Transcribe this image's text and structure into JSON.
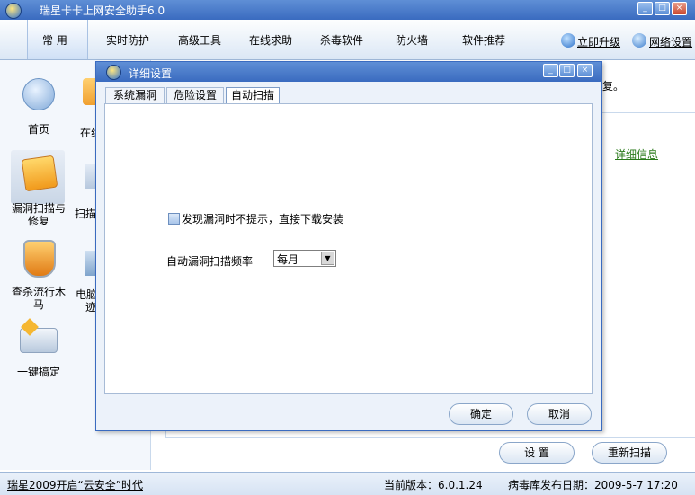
{
  "app": {
    "title": "瑞星卡卡上网安全助手6.0"
  },
  "nav": {
    "tabs": [
      "常 用",
      "实时防护",
      "高级工具",
      "在线求助",
      "杀毒软件",
      "防火墙",
      "软件推荐"
    ],
    "upgrade_label": "立即升级",
    "network_label": "网络设置"
  },
  "sidebar": {
    "col1": [
      {
        "label": "首页"
      },
      {
        "label": "漏洞扫描与修复"
      },
      {
        "label": "查杀流行木马"
      },
      {
        "label": "一键搞定"
      }
    ],
    "col2": [
      {
        "label": "在线"
      },
      {
        "label": "扫描"
      },
      {
        "label": "电脑"
      },
      {
        "label": "迹"
      }
    ]
  },
  "content": {
    "message_suffix": "复。",
    "detail_link": "详细信息",
    "settings_button": "设 置",
    "rescan_button": "重新扫描"
  },
  "status": {
    "left_text": "瑞星2009开启“云安全”时代",
    "version_text": "当前版本：6.0.1.24",
    "virus_db_text": "病毒库发布日期：2009-5-7 17:20"
  },
  "dialog": {
    "title": "详细设置",
    "tabs": [
      "系统漏洞",
      "危险设置",
      "自动扫描"
    ],
    "active_tab": "自动扫描",
    "checkbox_label": "发现漏洞时不提示，直接下载安装",
    "frequency_label": "自动漏洞扫描频率",
    "frequency_value": "每月",
    "ok_button": "确定",
    "cancel_button": "取消"
  }
}
